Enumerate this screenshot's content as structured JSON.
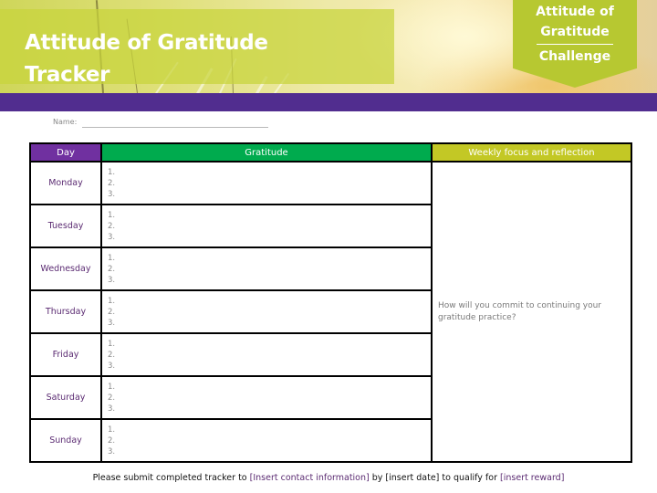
{
  "header": {
    "title_line1": "Attitude of Gratitude",
    "title_line2": "Tracker",
    "badge": {
      "line1": "Attitude of",
      "line2": "Gratitude",
      "line3": "Challenge"
    }
  },
  "form": {
    "name_label": "Name:",
    "name_value": ""
  },
  "table": {
    "headers": {
      "day": "Day",
      "gratitude": "Gratitude",
      "weekly": "Weekly focus and reflection"
    },
    "weekly_prompt": "How will you commit to continuing your gratitude practice?",
    "numbers": [
      "1.",
      "2.",
      "3."
    ],
    "rows": [
      {
        "day": "Monday"
      },
      {
        "day": "Tuesday"
      },
      {
        "day": "Wednesday"
      },
      {
        "day": "Thursday"
      },
      {
        "day": "Friday"
      },
      {
        "day": "Saturday"
      },
      {
        "day": "Sunday"
      }
    ]
  },
  "footer": {
    "prefix": "Please submit completed tracker to ",
    "contact": "[Insert contact information]",
    "middle": " by [insert date] to qualify for ",
    "reward": "[insert reward]"
  },
  "colors": {
    "purple": "#512d8f",
    "day_header": "#7030a0",
    "gratitude_header": "#00ab4e",
    "weekly_header": "#c3c825",
    "badge": "#b7c831"
  }
}
